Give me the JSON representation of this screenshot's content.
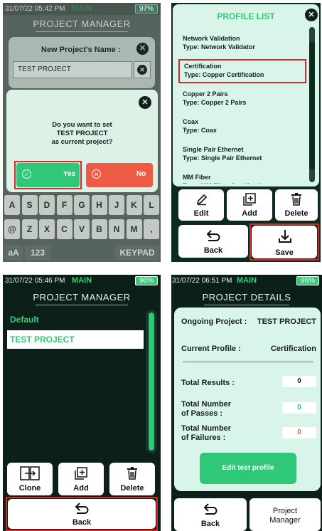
{
  "p1": {
    "status": {
      "time": "31/07/22 05:42 PM",
      "mode": "MAIN",
      "battery": "97%"
    },
    "title": "PROJECT MANAGER",
    "name_dialog": {
      "title": "New Project's Name :",
      "input_value": "TEST PROJECT"
    },
    "confirm": {
      "line1": "Do you want to set",
      "line2": "TEST PROJECT",
      "line3": "as current project?",
      "yes": "Yes",
      "no": "No"
    },
    "keys_row1": [
      "A",
      "S",
      "D",
      "F",
      "G",
      "H",
      "J",
      "K",
      "L"
    ],
    "keys_row2": [
      "@",
      "Z",
      "X",
      "C",
      "V",
      "B",
      "N",
      "M",
      ","
    ],
    "keys_row3": {
      "case": "aA",
      "num": "123",
      "keypad": "KEYPAD"
    }
  },
  "p2": {
    "title": "PROFILE LIST",
    "profiles": [
      {
        "name": "Network Validation",
        "type": "Type: Network Validator"
      },
      {
        "name": "Certification",
        "type": "Type: Copper Certification"
      },
      {
        "name": "Copper 2 Pairs",
        "type": "Type: Copper 2 Pairs"
      },
      {
        "name": "Coax",
        "type": "Type: Coax"
      },
      {
        "name": "Single Pair Ethernet",
        "type": "Type: Single Pair Ethernet"
      },
      {
        "name": "MM Fiber",
        "type": "Type: MM Fiber Certification"
      }
    ],
    "actions": {
      "edit": "Edit",
      "add": "Add",
      "delete": "Delete",
      "back": "Back",
      "save": "Save"
    }
  },
  "p3": {
    "status": {
      "time": "31/07/22 05:46 PM",
      "mode": "MAIN",
      "battery": "96%"
    },
    "title": "PROJECT MANAGER",
    "projects": [
      "Default",
      "TEST PROJECT"
    ],
    "actions": {
      "clone": "Clone",
      "add": "Add",
      "delete": "Delete",
      "back": "Back"
    }
  },
  "p4": {
    "status": {
      "time": "31/07/22 06:51 PM",
      "mode": "MAIN",
      "battery": "96%"
    },
    "title": "PROJECT DETAILS",
    "ongoing_label": "Ongoing Project :",
    "ongoing_value": "TEST PROJECT",
    "profile_label": "Current Profile :",
    "profile_value": "Certification",
    "total_results_label": "Total Results :",
    "total_results": "0",
    "passes_label_1": "Total Number",
    "passes_label_2": "of Passes :",
    "passes": "0",
    "failures_label_1": "Total Number",
    "failures_label_2": "of Failures :",
    "failures": "0",
    "edit_profile": "Edit test profile",
    "back": "Back",
    "pm_line1": "Project",
    "pm_line2": "Manager"
  },
  "colors": {
    "accent_green": "#2fc878",
    "no_red": "#ee5a44",
    "highlight_red": "#d42a2a",
    "mint": "#d9f4e8"
  }
}
